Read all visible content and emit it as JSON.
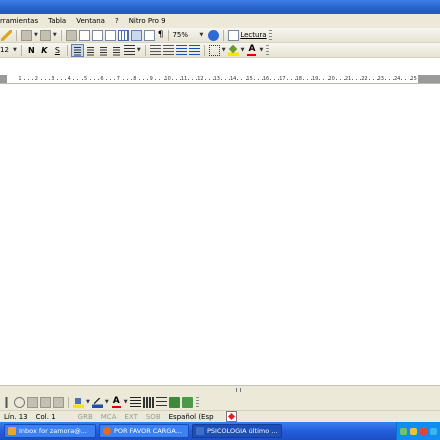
{
  "menu": {
    "items": [
      "rramientas",
      "Tabla",
      "Ventana",
      "?",
      "Nitro Pro 9"
    ]
  },
  "toolbar1": {
    "zoom": "75%",
    "reading_label": "Lectura"
  },
  "toolbar2": {
    "font_size": "12",
    "bold": "N",
    "italic": "K",
    "underline": "S",
    "font_color": "#e00000"
  },
  "ruler": {
    "numbers": [
      "1",
      "2",
      "3",
      "4",
      "5",
      "6",
      "7",
      "8",
      "9",
      "10",
      "11",
      "12",
      "13",
      "14",
      "15",
      "16",
      "17",
      "18",
      "19",
      "20",
      "21",
      "22",
      "23",
      "24",
      "25"
    ]
  },
  "status": {
    "page": "Lín. 13",
    "column": "Col. 1",
    "grb": "GRB",
    "mca": "MCA",
    "ext": "EXT",
    "sob": "SOB",
    "language": "Español (Esp"
  },
  "taskbar": {
    "tasks": [
      {
        "label": "Inbox for zamora@...",
        "icon": "outlook-icon",
        "color": "#e8a33a"
      },
      {
        "label": "POR FAVOR CARGA...",
        "icon": "firefox-icon",
        "color": "#e26b1f"
      },
      {
        "label": "PSICOLOGIA último ...",
        "icon": "word-icon",
        "color": "#3d6fc9"
      }
    ]
  }
}
